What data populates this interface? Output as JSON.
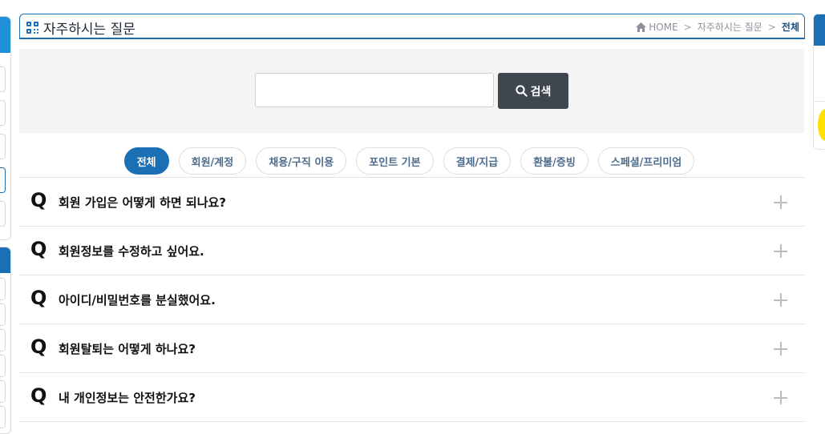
{
  "header": {
    "title": "자주하시는 질문",
    "breadcrumb": [
      "HOME",
      "자주하시는 질문",
      "전체"
    ]
  },
  "search": {
    "value": "",
    "placeholder": "",
    "button_label": "검색"
  },
  "tabs": [
    {
      "label": "전체",
      "active": true
    },
    {
      "label": "회원/계정",
      "active": false
    },
    {
      "label": "채용/구직 이용",
      "active": false
    },
    {
      "label": "포인트 기본",
      "active": false
    },
    {
      "label": "결제/지급",
      "active": false
    },
    {
      "label": "환불/증빙",
      "active": false
    },
    {
      "label": "스페셜/프리미엄",
      "active": false
    }
  ],
  "faq": {
    "q_mark": "Q",
    "items": [
      {
        "question": "회원 가입은 어떻게 하면 되나요?"
      },
      {
        "question": "회원정보를 수정하고 싶어요."
      },
      {
        "question": "아이디/비밀번호를 분실했어요."
      },
      {
        "question": "회원탈퇴는 어떻게 하나요?"
      },
      {
        "question": "내 개인정보는 안전한가요?"
      }
    ]
  },
  "colors": {
    "accent": "#1a6fb5",
    "search_button": "#3e464f",
    "search_bg": "#f4f4f4"
  },
  "icons": {
    "title": "grid-menu-icon",
    "breadcrumb": "home-icon",
    "search": "search-icon",
    "expand": "plus-icon"
  }
}
